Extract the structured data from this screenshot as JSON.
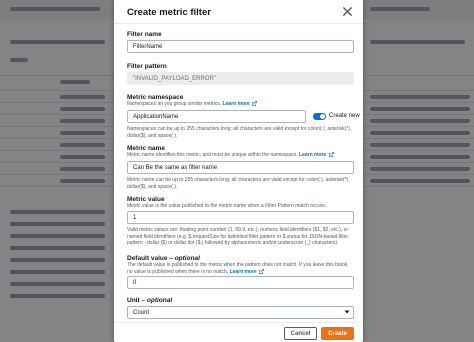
{
  "modal": {
    "title": "Create metric filter"
  },
  "filter_name": {
    "label": "Filter name",
    "value": "FilterName"
  },
  "filter_pattern": {
    "label": "Filter pattern",
    "value": "\"INVALID_PAYLOAD_ERROR\""
  },
  "metric_namespace": {
    "label": "Metric namespace",
    "description": "Namespaces let you group similar metrics.",
    "learn_more": "Learn more",
    "value": "ApplicationName",
    "toggle_label": "Create new",
    "constraint": "Namespaces can be up to 255 characters long; all characters are valid except for colon(:), asterisk(*), dollar($), and space( )."
  },
  "metric_name": {
    "label": "Metric name",
    "description": "Metric name identifies this metric, and must be unique within the namespace.",
    "learn_more": "Learn more",
    "value": "Can Be the same as filter name",
    "constraint": "Metric name can be up to 255 characters long; all characters are valid except for colon(:), asterisk(*), dollar($), and space( )."
  },
  "metric_value": {
    "label": "Metric value",
    "description": "Metric value is the value published to the metric name when a Filter Pattern match occurs.",
    "value": "1",
    "constraint": "Valid metric values are: floating point number (1, 99.9, etc.), numeric field identifiers ($1, $2, etc.), or named field identifiers (e.g. $.requestSize for delimited filter pattern or $.status for JSON-based filter pattern - dollar ($) or dollar dot ($.) followed by alphanumeric and/or underscore (_) characters)."
  },
  "default_value": {
    "label": "Default value",
    "optional": "optional",
    "description": "The default value is published to the metric when the pattern does not match. If you leave this blank, no value is published when there is no match.",
    "learn_more": "Learn more",
    "value": "0"
  },
  "unit": {
    "label": "Unit",
    "optional": "optional",
    "value": "Count"
  },
  "footer": {
    "cancel": "Cancel",
    "create": "Create"
  },
  "colors": {
    "accent": "#0073bb",
    "primary_button": "#ec7211"
  }
}
